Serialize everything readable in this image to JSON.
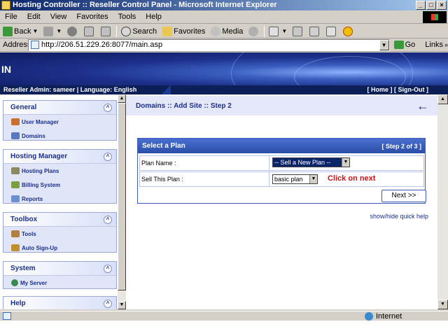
{
  "window": {
    "title": "Hosting Controller :: Reseller Control Panel - Microsoft Internet Explorer",
    "minimize": "_",
    "maximize": "□",
    "close": "×"
  },
  "menu": [
    "File",
    "Edit",
    "View",
    "Favorites",
    "Tools",
    "Help"
  ],
  "toolbar": {
    "back": "Back",
    "search": "Search",
    "favorites": "Favorites",
    "media": "Media"
  },
  "address": {
    "label": "Address",
    "url": "http://206.51.229.26:8077/main.asp",
    "go": "Go",
    "links": "Links",
    "links_chevron": "»"
  },
  "banner": {
    "label": "IN"
  },
  "infostrip": {
    "user_info": "Reseller Admin: sameer | Language: English",
    "home": "[ Home ]",
    "signout": "[ Sign-Out ]"
  },
  "sidebar": {
    "panels": [
      {
        "title": "General",
        "items": [
          "User Manager",
          "Domains"
        ]
      },
      {
        "title": "Hosting Manager",
        "items": [
          "Hosting Plans",
          "Billing System",
          "Reports"
        ]
      },
      {
        "title": "Toolbox",
        "items": [
          "Tools",
          "Auto Sign-Up"
        ]
      },
      {
        "title": "System",
        "items": [
          "My Server"
        ]
      },
      {
        "title": "Help",
        "items": []
      }
    ],
    "collapse_glyph": "^"
  },
  "main": {
    "breadcrumb": "Domains :: Add Site :: Step 2",
    "back_arrow": "←",
    "plan_box": {
      "title": "Select a Plan",
      "step": "[ Step 2 of 3 ]",
      "rows": [
        {
          "label": "Plan Name :",
          "value": "-- Sell a New Plan --"
        },
        {
          "label": "Sell This Plan :",
          "value": "basic plan"
        }
      ],
      "hint": "Click on next",
      "next_button": "Next >>"
    },
    "quick_help": "show/hide quick help"
  },
  "statusbar": {
    "zone": "Internet"
  },
  "colors": {
    "accent": "#1c2f8a",
    "panel_bg": "#e0e6f8",
    "header_blue": "#2a4ea8",
    "hint_red": "#d01010"
  }
}
